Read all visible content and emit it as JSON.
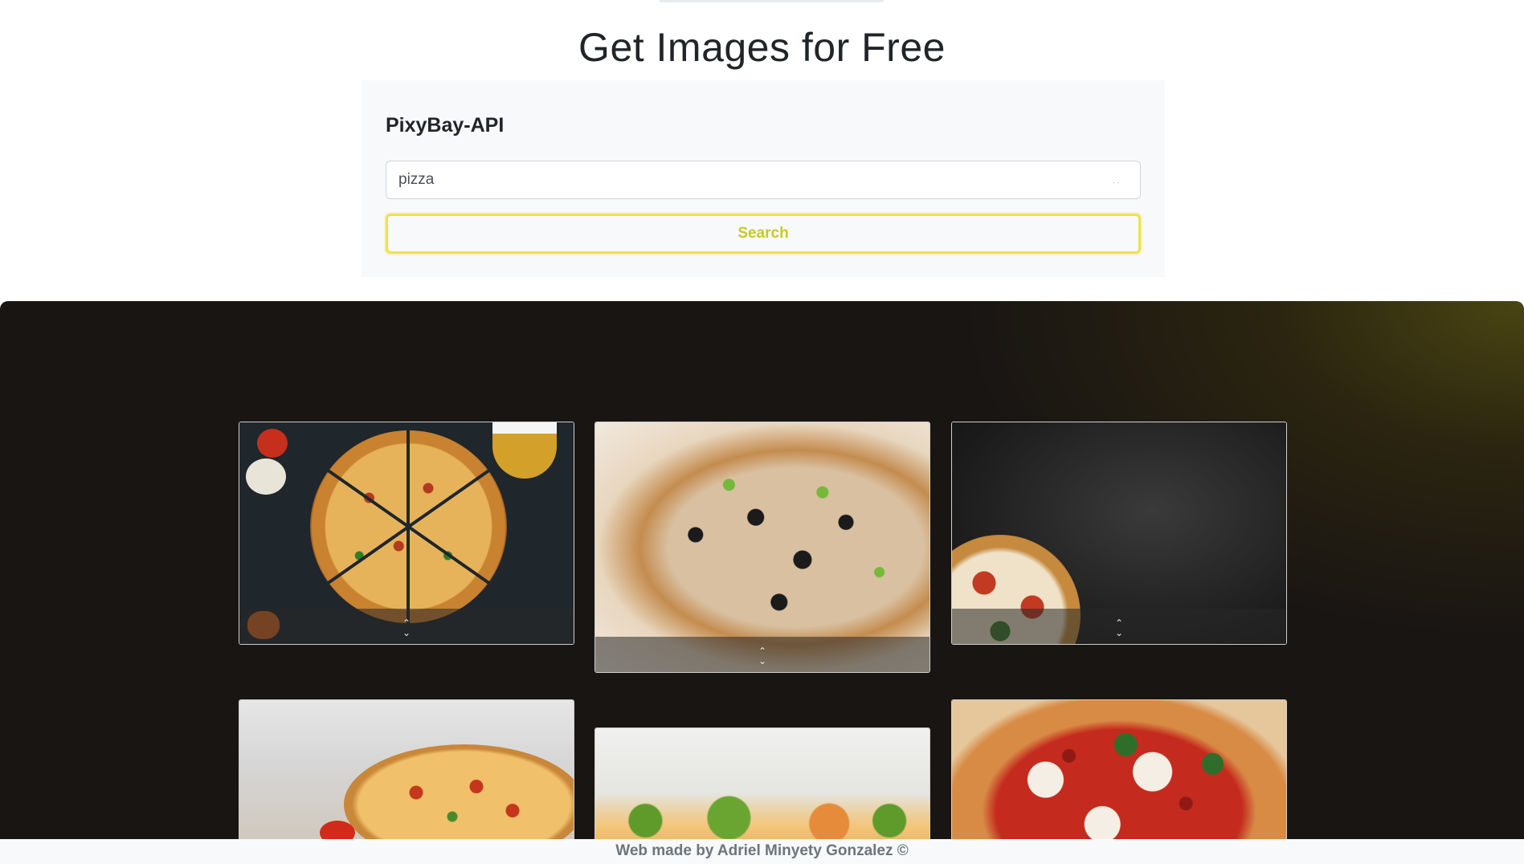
{
  "header": {
    "title": "Get Images for Free"
  },
  "panel": {
    "title": "PixyBay-API",
    "search_value": "pizza",
    "input_hint": ". .",
    "search_button_label": "Search"
  },
  "gallery": {
    "cards": [
      {
        "alt": "pizza slices on dark slate"
      },
      {
        "alt": "pizza with olives close-up"
      },
      {
        "alt": "pizza on black background"
      },
      {
        "alt": "pizza on wooden board"
      },
      {
        "alt": "salad with vegetables"
      },
      {
        "alt": "margherita pizza"
      }
    ]
  },
  "footer": {
    "text": "Web made by Adriel Minyety Gonzalez ©"
  },
  "colors": {
    "accent": "#f0e14a",
    "gallery_bg": "#191513"
  }
}
